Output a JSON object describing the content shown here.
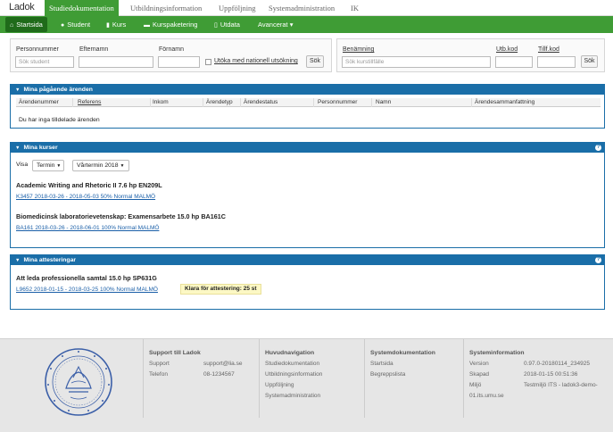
{
  "app": {
    "logo": "Ladok",
    "top_tabs": [
      "Studiedokumentation",
      "Utbildningsinformation",
      "Uppföljning",
      "Systemadministration",
      "IK"
    ]
  },
  "subnav": [
    {
      "label": "Startsida",
      "icon": "home-icon"
    },
    {
      "label": "Student",
      "icon": "user-icon"
    },
    {
      "label": "Kurs",
      "icon": "book-icon"
    },
    {
      "label": "Kurspaketering",
      "icon": "folder-icon"
    },
    {
      "label": "Utdata",
      "icon": "document-icon"
    },
    {
      "label": "Avancerat ▾",
      "icon": ""
    }
  ],
  "student_search": {
    "labels": [
      "Personnummer",
      "Efternamn",
      "Förnamn"
    ],
    "placeholder": "Sök student",
    "checkbox_label": "Utöka med nationell utsökning",
    "button": "Sök"
  },
  "course_search": {
    "labels": [
      "Benämning",
      "Utb.kod",
      "Tillf.kod"
    ],
    "placeholder": "Sök kurstillfälle",
    "button": "Sök"
  },
  "arenden": {
    "title": "Mina pågående ärenden",
    "columns": [
      "Ärendenummer",
      "Referens",
      "Inkom",
      "Ärendetyp",
      "Ärendestatus",
      "Personnummer",
      "Namn",
      "Ärendesammanfattning"
    ],
    "empty_text": "Du har inga tilldelade ärenden"
  },
  "kurser": {
    "title": "Mina kurser",
    "show_label": "Visa",
    "filter1": "Termin",
    "filter2": "Vårtermin 2018",
    "courses": [
      {
        "name": "Academic Writing and Rhetoric II 7.6 hp EN209L",
        "link": "K3457 2018-03-26 - 2018-05-03 50% Normal MALMÖ"
      },
      {
        "name": "Biomedicinsk laboratorievetenskap: Examensarbete 15.0 hp BA161C",
        "link": "BA161 2018-03-26 - 2018-06-01 100% Normal MALMÖ"
      }
    ]
  },
  "attesteringar": {
    "title": "Mina attesteringar",
    "course_name": "Att leda professionella samtal 15.0 hp SP631G",
    "link": "L9652 2018-01-15 - 2018-03-25 100% Normal MALMÖ",
    "badge": "Klara för attestering: 25 st"
  },
  "footer": {
    "support": {
      "title": "Support till Ladok",
      "rows": [
        [
          "Support",
          "support@lia.se"
        ],
        [
          "Telefon",
          "08-1234567"
        ]
      ]
    },
    "huvudnav": {
      "title": "Huvudnavigation",
      "items": [
        "Studiedokumentation",
        "Utbildningsinformation",
        "Uppföljning",
        "Systemadministration"
      ]
    },
    "systemdok": {
      "title": "Systemdokumentation",
      "items": [
        "Startsida",
        "Begreppslista"
      ]
    },
    "sysinfo": {
      "title": "Systeminformation",
      "rows": [
        [
          "Version",
          "0.97.0-20180114_234925"
        ],
        [
          "Skapad",
          "2018-01-15 00:51:36"
        ],
        [
          "Miljö",
          "Testmiljö ITS - ladok3-demo-"
        ]
      ],
      "extra": "01.its.umu.se"
    }
  }
}
